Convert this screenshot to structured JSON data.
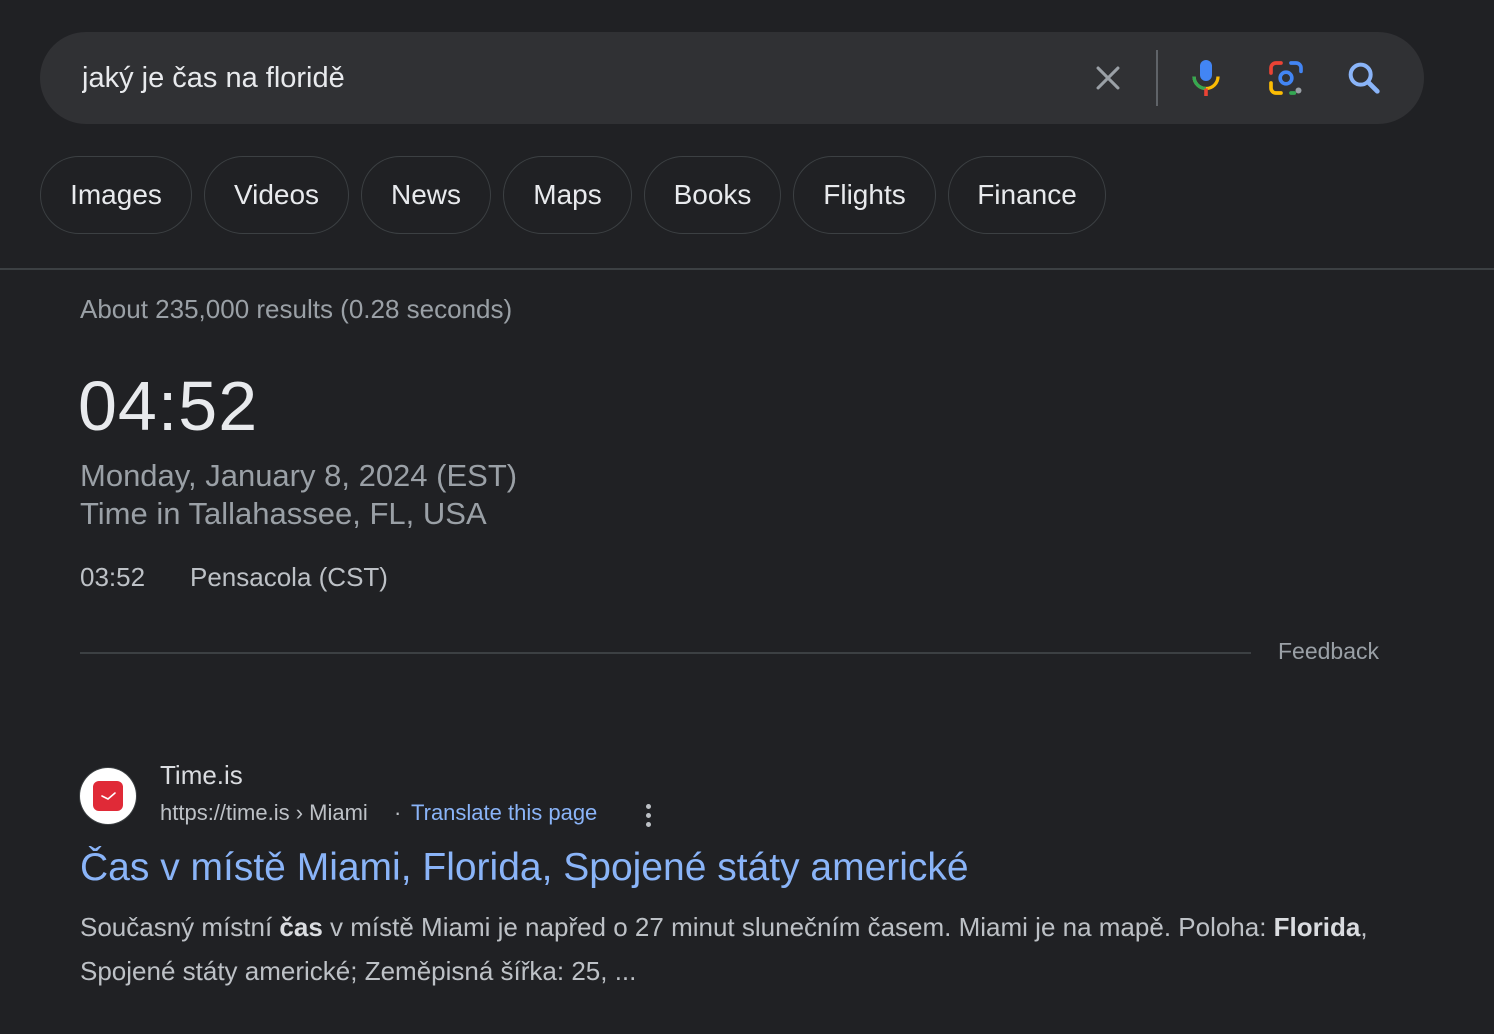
{
  "search": {
    "query": "jaký je čas na floridě"
  },
  "icons": {
    "clear": "close-icon",
    "mic": "microphone-icon",
    "lens": "google-lens-icon",
    "search": "search-icon"
  },
  "chips": [
    "Images",
    "Videos",
    "News",
    "Maps",
    "Books",
    "Flights",
    "Finance"
  ],
  "stats": "About 235,000 results (0.28 seconds)",
  "clock": {
    "time": "04:52",
    "date": "Monday, January 8, 2024 (EST)",
    "place": "Time in Tallahassee, FL, USA",
    "alt_time": "03:52",
    "alt_place": "Pensacola (CST)"
  },
  "feedback": "Feedback",
  "result": {
    "site_name": "Time.is",
    "url": "https://time.is › Miami",
    "separator": "·",
    "translate": "Translate this page",
    "title": "Čas v místě Miami, Florida, Spojené státy americké",
    "snippet": {
      "p1": "Současný místní ",
      "b1": "čas",
      "p2": " v místě Miami je napřed o 27 minut slunečním časem. Miami je na mapě. Poloha: ",
      "b2": "Florida",
      "p3": ", Spojené státy americké; Zeměpisná šířka: 25, ..."
    }
  },
  "colors": {
    "background": "#202124",
    "link": "#8ab4f8",
    "favicon": "#e02a37"
  }
}
